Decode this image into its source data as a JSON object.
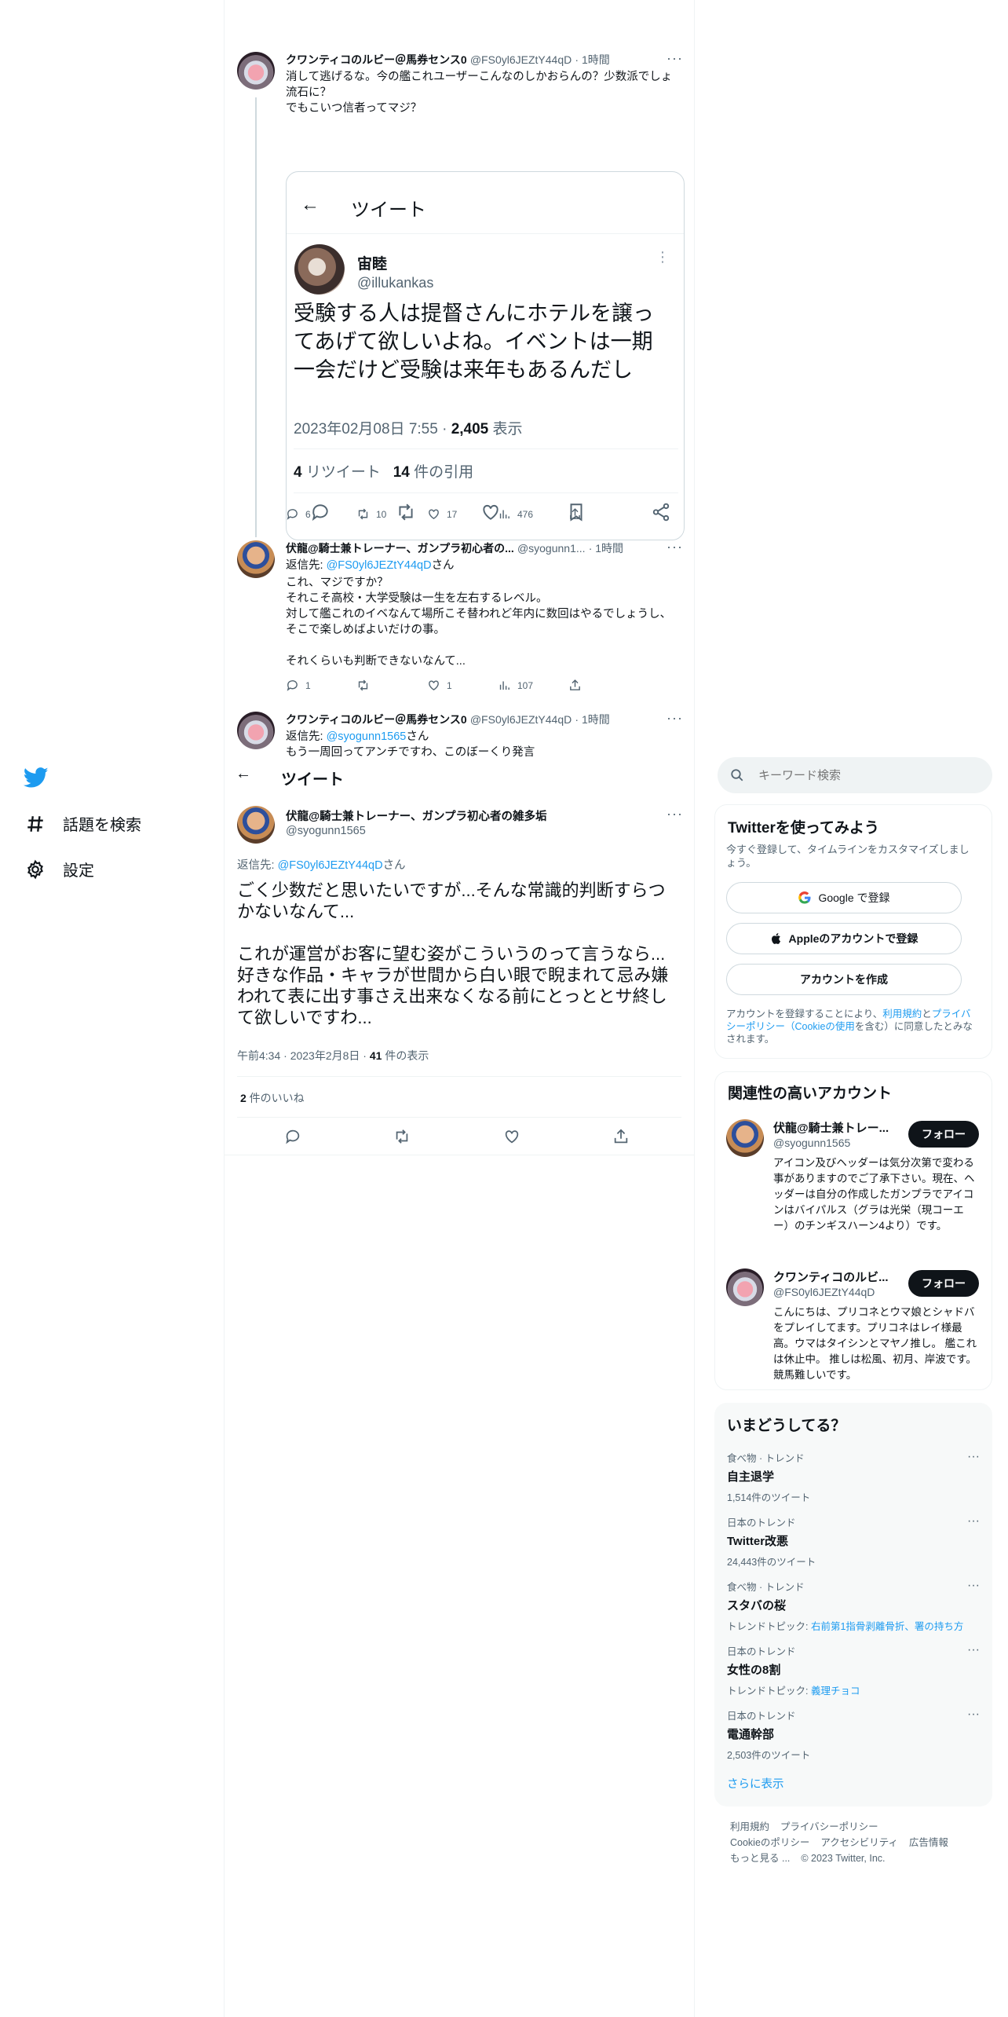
{
  "nav": {
    "items": [
      {
        "label": "話題を検索",
        "icon": "hashtag-icon"
      },
      {
        "label": "設定",
        "icon": "gear-icon"
      }
    ]
  },
  "thread": [
    {
      "name": "クワンティコのルビー＠馬券センス0",
      "handle": "@FS0yl6JEZtY44qD",
      "time": "· 1時間",
      "text": "消して逃げるな。今の艦これユーザーこんなのしかおらんの？少数派でしょ流石に？\nでもこいつ信者ってマジ？",
      "stats": {
        "reply": "6",
        "retweet": "10",
        "like": "17",
        "views": "476"
      }
    },
    {
      "name": "伏龍@騎士兼トレーナー、ガンプラ初心者の...",
      "handle": "@syogunn1...",
      "time": "· 1時間",
      "reply_prefix": "返信先: ",
      "reply_to": "@FS0yl6JEZtY44qD",
      "reply_suffix": "さん",
      "text": "これ、マジですか？\nそれこそ高校・大学受験は一生を左右するレベル。\n対して艦これのイベなんて場所こそ替われど年内に数回はやるでしょうし、そこで楽しめばよいだけの事。\n\nそれくらいも判断できないなんて...",
      "stats": {
        "reply": "1",
        "retweet": "",
        "like": "1",
        "views": "107"
      }
    },
    {
      "name": "クワンティコのルビー＠馬券センス0",
      "handle": "@FS0yl6JEZtY44qD",
      "time": "· 1時間",
      "reply_prefix": "返信先: ",
      "reply_to": "@syogunn1565",
      "reply_suffix": "さん",
      "text": "もう一周回ってアンチですわ、このぼーくり発言"
    }
  ],
  "card": {
    "header_title": "ツイート",
    "name": "宙睦",
    "handle": "@illukankas",
    "text": "受験する人は提督さんにホテルを譲ってあげて欲しいよね。イベントは一期一会だけど受験は来年もあるんだし",
    "date": "2023年02月08日 7:55 · ",
    "views_num": "2,405",
    "views_label": " 表示",
    "retweets_num": "4",
    "retweets_label": " リツイート",
    "quotes_num": "14",
    "quotes_label": " 件の引用"
  },
  "main_tweet": {
    "header_title": "ツイート",
    "name": "伏龍@騎士兼トレーナー、ガンプラ初心者の雑多垢",
    "handle": "@syogunn1565",
    "reply_prefix": "返信先: ",
    "reply_to": "@FS0yl6JEZtY44qD",
    "reply_suffix": "さん",
    "text": "ごく少数だと思いたいですが...そんな常識的判断すらつかないなんて...\n\nこれが運営がお客に望む姿がこういうのって言うなら...好きな作品・キャラが世間から白い眼で睨まれて忌み嫌われて表に出す事さえ出来なくなる前にとっととサ終して欲しいですわ...",
    "meta": "午前4:34 · 2023年2月8日 · ",
    "views_num": "41",
    "views_label": " 件の表示",
    "likes_num": "2",
    "likes_label": " 件のいいね"
  },
  "search": {
    "placeholder": "キーワード検索"
  },
  "signup": {
    "title": "Twitterを使ってみよう",
    "desc": "今すぐ登録して、タイムラインをカスタマイズしましょう。",
    "google": "Google で登録",
    "apple": "Appleのアカウントで登録",
    "create": "アカウントを作成",
    "terms_pre": "アカウントを登録することにより、",
    "terms_link": "利用規約",
    "terms_and": "と",
    "privacy_link": "プライバシーポリシー（Cookieの使用",
    "terms_post": "を含む）に同意したとみなされます。"
  },
  "related": {
    "title": "関連性の高いアカウント",
    "follow_label": "フォロー",
    "accounts": [
      {
        "name": "伏龍@騎士兼トレー...",
        "handle": "@syogunn1565",
        "bio": "アイコン及びヘッダーは気分次第で変わる事がありますのでご了承下さい。現在、ヘッダーは自分の作成したガンプラでアイコンはバイパルス（グラは光栄（現コーエー）のチンギスハーン4より）です。"
      },
      {
        "name": "クワンティコのルビ...",
        "handle": "@FS0yl6JEZtY44qD",
        "bio": "こんにちは、プリコネとウマ娘とシャドバをプレイしてます。プリコネはレイ様最高。ウマはタイシンとマヤノ推し。 艦これは休止中。 推しは松風、初月、岸波です。 競馬難しいです。"
      }
    ]
  },
  "trends": {
    "title": "いまどうしてる？",
    "items": [
      {
        "category": "食べ物 · トレンド",
        "name": "自主退学",
        "count": "1,514件のツイート"
      },
      {
        "category": "日本のトレンド",
        "name": "Twitter改悪",
        "count": "24,443件のツイート"
      },
      {
        "category": "食べ物 · トレンド",
        "name": "スタバの桜",
        "topic_label": "トレンドトピック: ",
        "topic": "右前第1指骨剥離骨折、署の持ち方"
      },
      {
        "category": "日本のトレンド",
        "name": "女性の8割",
        "topic_label": "トレンドトピック: ",
        "topic": "義理チョコ"
      },
      {
        "category": "日本のトレンド",
        "name": "電通幹部",
        "count": "2,503件のツイート"
      }
    ],
    "show_more": "さらに表示"
  },
  "footer": {
    "row1": [
      "利用規約",
      "プライバシーポリシー"
    ],
    "row2": [
      "Cookieのポリシー",
      "アクセシビリティ",
      "広告情報"
    ],
    "more": "もっと見る ...",
    "copyright": "© 2023 Twitter, Inc."
  },
  "colors": {
    "accent": "#1d9bf0",
    "text": "#0f1419",
    "muted": "#536471",
    "border": "#eff3f4"
  }
}
